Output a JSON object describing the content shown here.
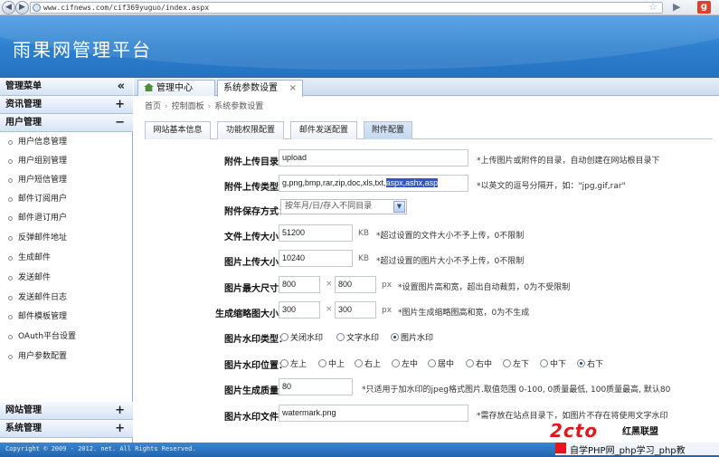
{
  "browser": {
    "url": "www.cifnews.com/cif369yuguo/index.aspx"
  },
  "header": {
    "title": "雨果网管理平台"
  },
  "sidebar": {
    "menu_title": "管理菜单",
    "collapse_symbol": "«",
    "sections": [
      {
        "label": "资讯管理",
        "symbol": "+"
      },
      {
        "label": "用户管理",
        "symbol": "−"
      }
    ],
    "items": [
      "用户信息管理",
      "用户组别管理",
      "用户短信管理",
      "邮件订阅用户",
      "邮件退订用户",
      "反弹邮件地址",
      "生成邮件",
      "发送邮件",
      "发送邮件日志",
      "邮件模板管理",
      "OAuth平台设置",
      "用户参数配置"
    ],
    "bottom_sections": [
      {
        "label": "网站管理",
        "symbol": "+"
      },
      {
        "label": "系统管理",
        "symbol": "+"
      }
    ]
  },
  "tabs": [
    {
      "label": "管理中心"
    },
    {
      "label": "系统参数设置",
      "close": "×"
    }
  ],
  "breadcrumb": [
    "首页",
    "控制面板",
    "系统参数设置"
  ],
  "subtabs": [
    "网站基本信息",
    "功能权限配置",
    "邮件发送配置",
    "附件配置"
  ],
  "form": {
    "upload_dir": {
      "label": "附件上传目录：",
      "value": "upload",
      "hint": "*上传图片或附件的目录，自动创建在网站根目录下"
    },
    "upload_types": {
      "label": "附件上传类型：",
      "value_plain": "g,png,bmp,rar,zip,doc,xls,txt,",
      "value_selected": "aspx,ashx,asp",
      "hint": "*以英文的逗号分隔开，如：\"jpg,gif,rar\""
    },
    "save_mode": {
      "label": "附件保存方式：",
      "value": "按年月/日/存入不同目录"
    },
    "file_size": {
      "label": "文件上传大小：",
      "value": "51200",
      "unit": "KB",
      "hint": "*超过设置的文件大小不予上传，0不限制"
    },
    "image_size": {
      "label": "图片上传大小：",
      "value": "10240",
      "unit": "KB",
      "hint": "*超过设置的图片大小不予上传，0不限制"
    },
    "max_dim": {
      "label": "图片最大尺寸：",
      "width": "800",
      "height": "800",
      "unit": "px",
      "hint": "*设置图片高和宽，超出自动裁剪，0为不受限制"
    },
    "thumb_dim": {
      "label": "生成缩略图大小：",
      "width": "300",
      "height": "300",
      "unit": "px",
      "hint": "*图片生成缩略图高和宽，0为不生成"
    },
    "times_sign": "×",
    "watermark_type": {
      "label": "图片水印类型：",
      "options": [
        "关闭水印",
        "文字水印",
        "图片水印"
      ],
      "selected": 2
    },
    "watermark_pos": {
      "label": "图片水印位置：",
      "options": [
        "左上",
        "中上",
        "右上",
        "左中",
        "居中",
        "右中",
        "左下",
        "中下",
        "右下"
      ],
      "selected": 8
    },
    "quality": {
      "label": "图片生成质量：",
      "value": "80",
      "hint": "*只适用于加水印的jpeg格式图片.取值范围 0-100, 0质量最低, 100质量最高, 默认80"
    },
    "watermark_file": {
      "label": "图片水印文件：",
      "value": "watermark.png",
      "hint": "*需存放在站点目录下，如图片不存在将使用文字水印"
    }
  },
  "footer": {
    "copyright": "Copyright © 2009 - 2012. net. All Rights Reserved."
  },
  "watermark": {
    "logo": "2cto",
    "brand": "红黑联盟",
    "text": "自学PHP网_php学习_php教"
  },
  "colors": {
    "banner": "#2d7fce",
    "footer": "#2164ad",
    "selection": "#3355cc"
  }
}
